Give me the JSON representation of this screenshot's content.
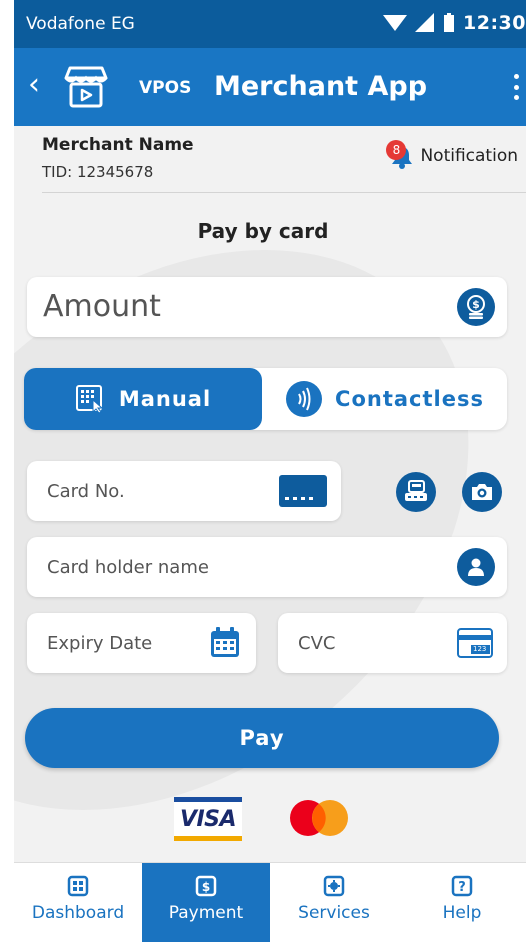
{
  "status_bar": {
    "carrier": "Vodafone EG",
    "time": "12:30"
  },
  "app_bar": {
    "brand": "VPOS",
    "title": "Merchant App"
  },
  "merchant": {
    "name": "Merchant Name",
    "tid": "TID: 12345678"
  },
  "notification": {
    "label": "Notification",
    "count": "8"
  },
  "payment": {
    "section_title": "Pay by card",
    "amount_placeholder": "Amount",
    "mode_manual": "Manual",
    "mode_contactless": "Contactless",
    "card_no_placeholder": "Card No.",
    "card_holder_placeholder": "Card holder name",
    "expiry_placeholder": "Expiry Date",
    "cvc_placeholder": "CVC",
    "cvc_icon_text": "123",
    "pay_label": "Pay",
    "visa_text": "VISA"
  },
  "nav": {
    "items": [
      {
        "label": "Dashboard",
        "icon": "dashboard-icon",
        "active": false
      },
      {
        "label": "Payment",
        "icon": "payment-icon",
        "active": true
      },
      {
        "label": "Services",
        "icon": "services-icon",
        "active": false
      },
      {
        "label": "Help",
        "icon": "help-icon",
        "active": false
      }
    ]
  },
  "colors": {
    "primary": "#1a73c0",
    "status_bar": "#0c5c9c",
    "icon_dark": "#0e5c9d",
    "badge": "#e53935"
  }
}
